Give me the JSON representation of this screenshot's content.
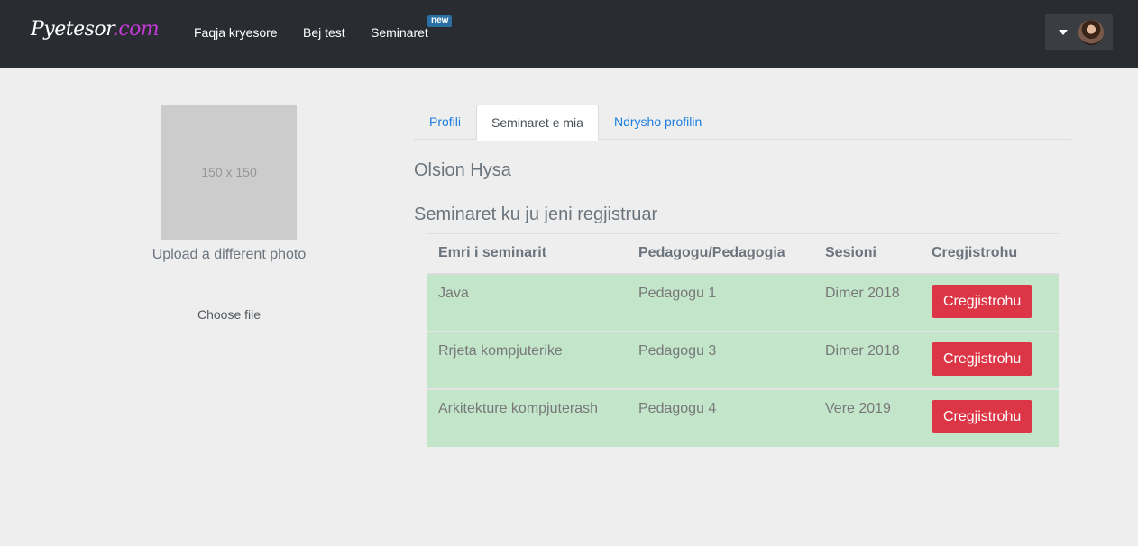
{
  "navbar": {
    "brand": "Pyetesor",
    "brand_suffix": ".com",
    "links": [
      {
        "label": "Faqja kryesore"
      },
      {
        "label": "Bej test"
      },
      {
        "label": "Seminaret"
      }
    ],
    "badge": "new"
  },
  "profile": {
    "photo_placeholder": "150 x 150",
    "upload_label": "Upload a different photo",
    "choose_file": "Choose file"
  },
  "tabs": [
    {
      "label": "Profili"
    },
    {
      "label": "Seminaret e mia",
      "active": true
    },
    {
      "label": "Ndrysho profilin"
    }
  ],
  "user": {
    "name": "Olsion Hysa"
  },
  "seminars": {
    "title": "Seminaret ku ju jeni regjistruar",
    "columns": [
      "Emri i seminarit",
      "Pedagogu/Pedagogia",
      "Sesioni",
      "Cregjistrohu"
    ],
    "rows": [
      {
        "name": "Java",
        "teacher": "Pedagogu 1",
        "session": "Dimer 2018",
        "action": "Cregjistrohu"
      },
      {
        "name": "Rrjeta kompjuterike",
        "teacher": "Pedagogu 3",
        "session": "Dimer 2018",
        "action": "Cregjistrohu"
      },
      {
        "name": "Arkitekture kompjuterash",
        "teacher": "Pedagogu 4",
        "session": "Vere 2019",
        "action": "Cregjistrohu"
      }
    ]
  },
  "colors": {
    "navbar": "#292c30",
    "danger": "#dc3545",
    "row_success": "#c3e6cb",
    "link": "#1c7ee0"
  }
}
